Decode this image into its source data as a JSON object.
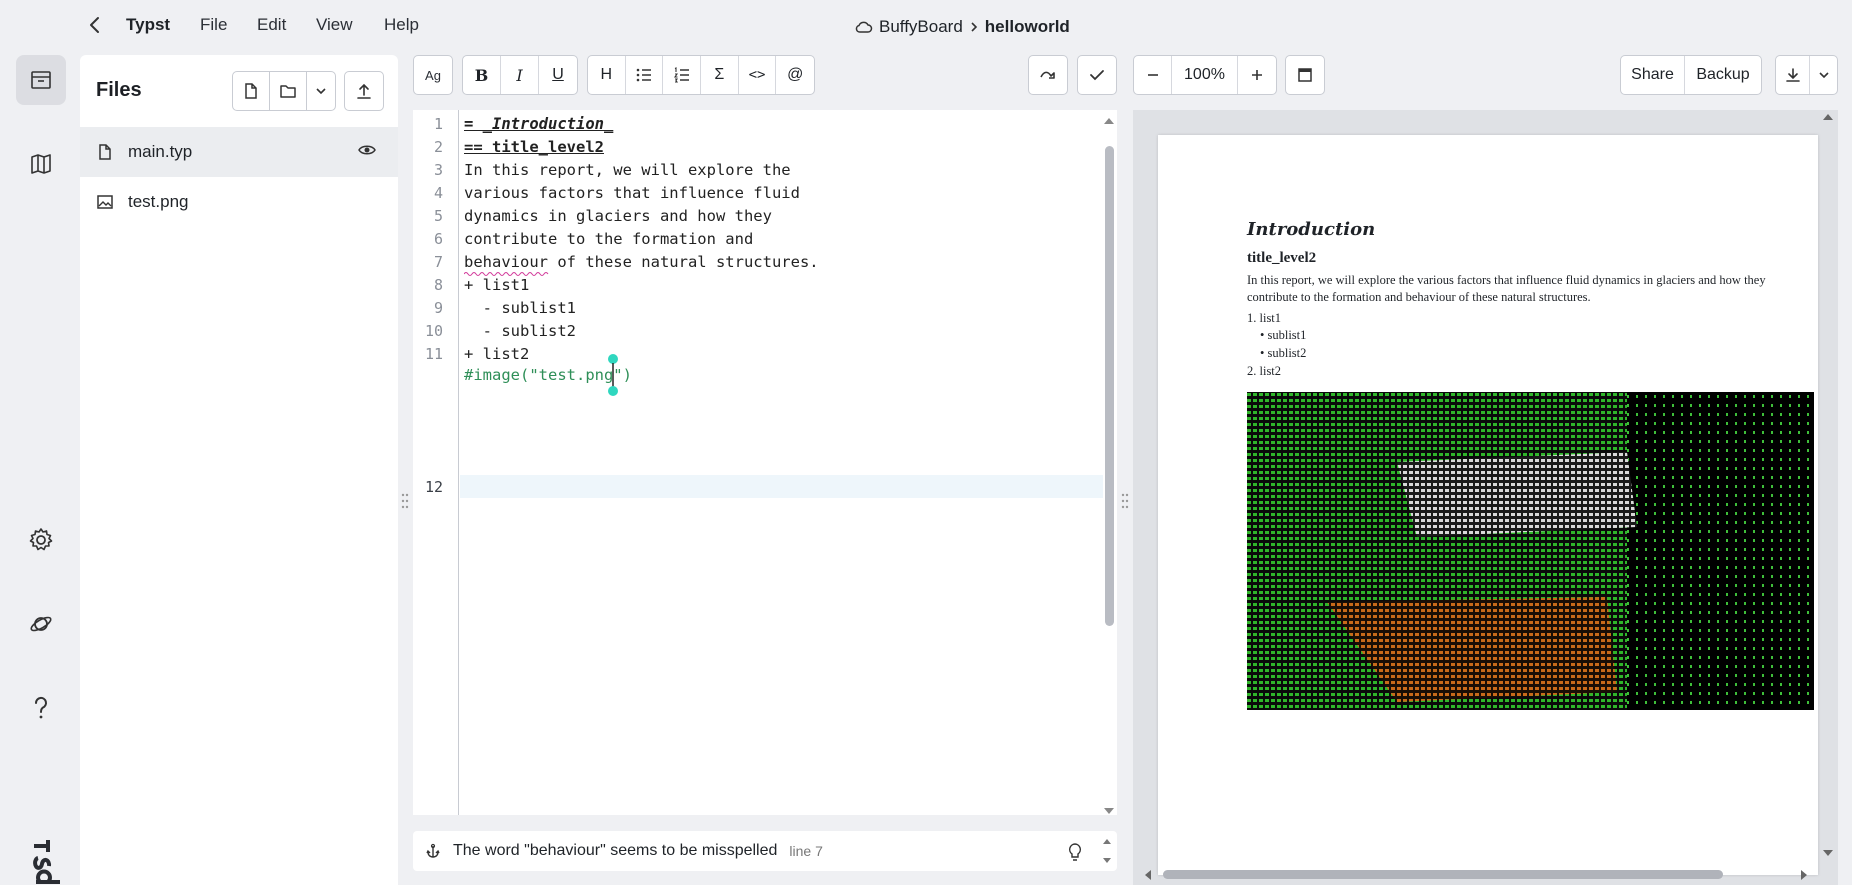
{
  "app": {
    "name": "Typst"
  },
  "menu": [
    "File",
    "Edit",
    "View",
    "Help"
  ],
  "breadcrumb": {
    "project": "BuffyBoard",
    "file": "helloworld"
  },
  "files_panel": {
    "title": "Files",
    "items": [
      {
        "name": "main.typ",
        "icon": "file-icon"
      },
      {
        "name": "test.png",
        "icon": "image-icon"
      }
    ]
  },
  "toolbar": {
    "ag": "Ag",
    "bold": "B",
    "italic": "I",
    "underline": "U",
    "heading": "H",
    "math": "Σ",
    "code": "<>",
    "mention": "@",
    "zoom": "100%",
    "share": "Share",
    "backup": "Backup"
  },
  "editor": {
    "line_numbers": [
      "1",
      "2",
      "3",
      "4",
      "5",
      "6",
      "7",
      "8",
      "9",
      "10",
      "11",
      "12"
    ],
    "lines": [
      "= _Introduction_",
      "== title_level2",
      "In this report, we will explore the",
      "various factors that influence fluid",
      "dynamics in glaciers and how they",
      "contribute to the formation and",
      "behaviour of these natural structures.",
      "+ list1",
      "  - sublist1",
      "  - sublist2",
      "+ list2",
      "#image(\"test.png\")"
    ]
  },
  "status": {
    "message": "The word \"behaviour\" seems to be misspelled",
    "line": "line 7"
  },
  "preview": {
    "h1": "Introduction",
    "h2": "title_level2",
    "paragraph": "In this report, we will explore the various factors that influence fluid dynamics in glaciers and how they contribute to the formation and behaviour of these natural structures.",
    "list1": "1.  list1",
    "sublist1": "•  sublist1",
    "sublist2": "•  sublist2",
    "list2": "2.  list2"
  },
  "colors": {
    "accent": "#1b7fd8",
    "heading_mark": "#b34a9a",
    "string": "#2f8f58",
    "cursor_handle": "#2fd7bf"
  }
}
